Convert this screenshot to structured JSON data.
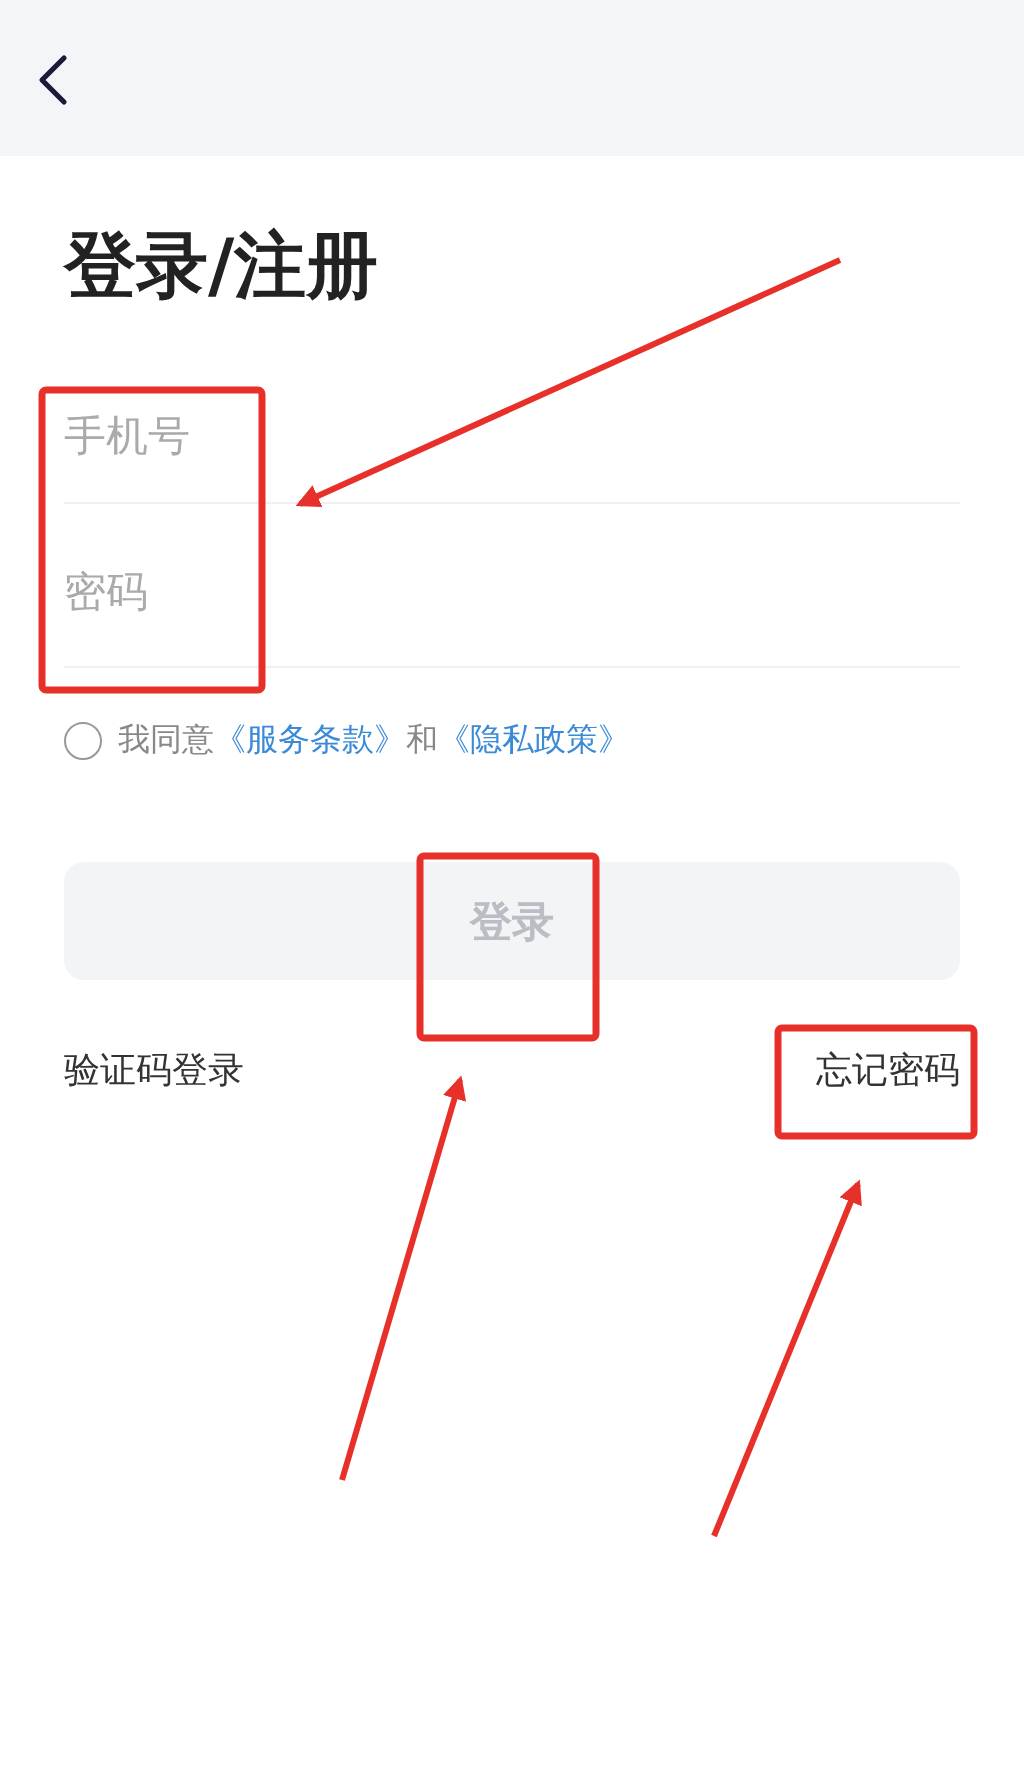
{
  "title": "登录/注册",
  "fields": [
    {
      "placeholder": "手机号"
    },
    {
      "placeholder": "密码"
    }
  ],
  "agreement": {
    "checked": false,
    "parts": [
      {
        "kind": "text",
        "text": "我同意"
      },
      {
        "kind": "link",
        "text": "《服务条款》"
      },
      {
        "kind": "text",
        "text": "和"
      },
      {
        "kind": "link",
        "text": "《隐私政策》"
      }
    ]
  },
  "login_button": {
    "label": "登录",
    "disabled": true
  },
  "links": [
    {
      "label": "验证码登录"
    },
    {
      "label": "忘记密码"
    }
  ]
}
